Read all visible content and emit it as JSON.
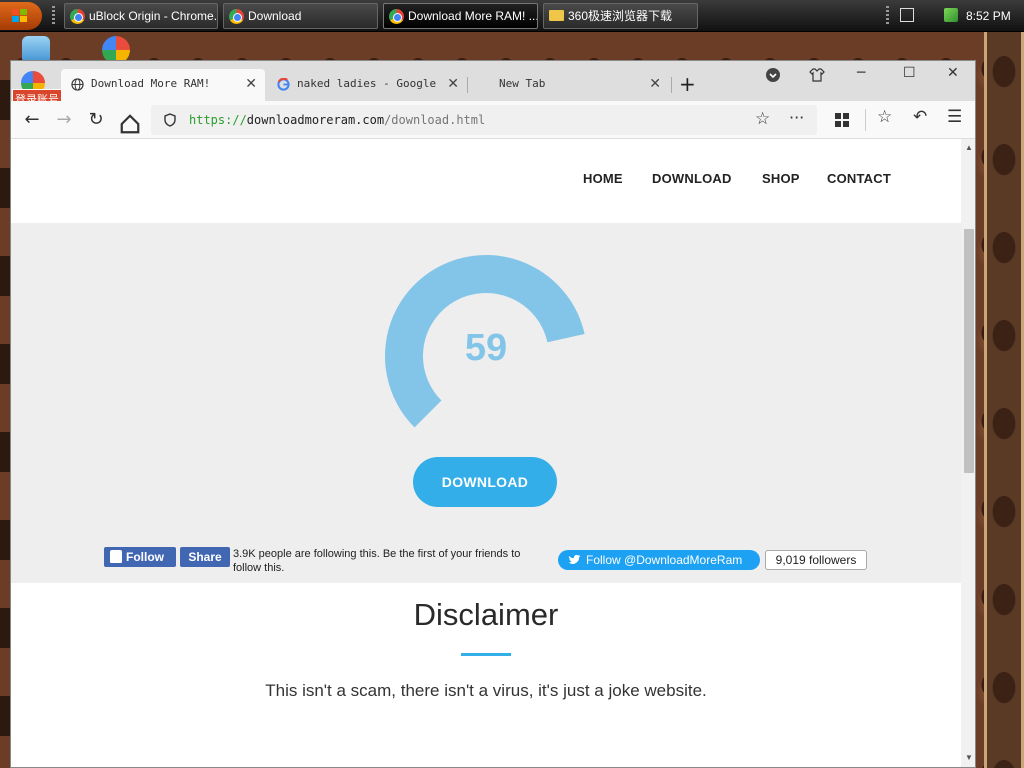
{
  "taskbar": {
    "tasks": [
      {
        "label": "uBlock Origin - Chrome..."
      },
      {
        "label": "Download"
      },
      {
        "label": "Download More RAM! ..."
      },
      {
        "label": "360极速浏览器下载"
      }
    ],
    "clock": "8:52 PM"
  },
  "browser": {
    "extension_badge": "登录账号",
    "tabs": [
      {
        "title": "Download More RAM!"
      },
      {
        "title": "naked ladies - Google Se"
      },
      {
        "title": "New Tab"
      }
    ],
    "url": {
      "protocol": "https://",
      "host": "downloadmoreram.com",
      "path": "/download.html"
    }
  },
  "site": {
    "nav": [
      "HOME",
      "DOWNLOAD",
      "SHOP",
      "CONTACT"
    ],
    "gauge": {
      "value": "59",
      "fill_fraction": 0.59,
      "color": "#83c5e8"
    },
    "download_button": "DOWNLOAD",
    "facebook": {
      "follow": "Follow",
      "share": "Share",
      "text": "3.9K people are following this. Be the first of your friends to follow this."
    },
    "twitter": {
      "follow": "Follow @DownloadMoreRam",
      "followers": "9,019 followers"
    },
    "disclaimer": {
      "title": "Disclaimer",
      "text": "This isn't a scam, there isn't a virus, it's just a joke website."
    }
  },
  "colors": {
    "accent": "#34aee8",
    "facebook": "#4267b2",
    "twitter": "#1da1f2"
  }
}
